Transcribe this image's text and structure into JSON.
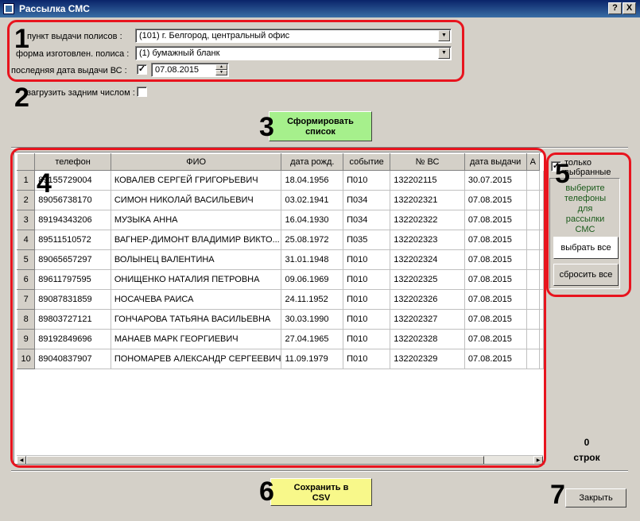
{
  "window": {
    "title": "Рассылка СМС",
    "help_label": "?",
    "close_label": "X"
  },
  "filters": {
    "issue_point_label": "пункт выдачи полисов :",
    "issue_point_value": "(101) г. Белгород, центральный офис",
    "policy_form_label": "форма изготовлен. полиса :",
    "policy_form_value": "(1) бумажный бланк",
    "last_date_label": "последняя дата выдачи ВС :",
    "last_date_checked": "✓",
    "last_date_value": "07.08.2015",
    "backdate_label": "загрузить задним числом :",
    "backdate_checked": ""
  },
  "actions": {
    "form_list_label_1": "Сформировать",
    "form_list_label_2": "список",
    "save_csv_label_1": "Сохранить в",
    "save_csv_label_2": "CSV",
    "close_label": "Закрыть"
  },
  "table": {
    "columns": [
      "телефон",
      "ФИО",
      "дата рожд.",
      "событие",
      "№ ВС",
      "дата выдачи",
      "А"
    ],
    "rows": [
      {
        "num": "1",
        "phone": "89155729004",
        "fio": "КОВАЛЕВ СЕРГЕЙ ГРИГОРЬЕВИЧ",
        "birth": "18.04.1956",
        "event": "П010",
        "vs": "132202115",
        "issued": "30.07.2015"
      },
      {
        "num": "2",
        "phone": "89056738170",
        "fio": "СИМОН НИКОЛАЙ ВАСИЛЬЕВИЧ",
        "birth": "03.02.1941",
        "event": "П034",
        "vs": "132202321",
        "issued": "07.08.2015"
      },
      {
        "num": "3",
        "phone": "89194343206",
        "fio": "МУЗЫКА АННА",
        "birth": "16.04.1930",
        "event": "П034",
        "vs": "132202322",
        "issued": "07.08.2015"
      },
      {
        "num": "4",
        "phone": "89511510572",
        "fio": "ВАГНЕР-ДИМОНТ ВЛАДИМИР ВИКТО...",
        "birth": "25.08.1972",
        "event": "П035",
        "vs": "132202323",
        "issued": "07.08.2015"
      },
      {
        "num": "5",
        "phone": "89065657297",
        "fio": "ВОЛЫНЕЦ ВАЛЕНТИНА",
        "birth": "31.01.1948",
        "event": "П010",
        "vs": "132202324",
        "issued": "07.08.2015"
      },
      {
        "num": "6",
        "phone": "89611797595",
        "fio": "ОНИЩЕНКО НАТАЛИЯ ПЕТРОВНА",
        "birth": "09.06.1969",
        "event": "П010",
        "vs": "132202325",
        "issued": "07.08.2015"
      },
      {
        "num": "7",
        "phone": "89087831859",
        "fio": "НОСАЧЕВА РАИСА",
        "birth": "24.11.1952",
        "event": "П010",
        "vs": "132202326",
        "issued": "07.08.2015"
      },
      {
        "num": "8",
        "phone": "89803727121",
        "fio": "ГОНЧАРОВА ТАТЬЯНА ВАСИЛЬЕВНА",
        "birth": "30.03.1990",
        "event": "П010",
        "vs": "132202327",
        "issued": "07.08.2015"
      },
      {
        "num": "9",
        "phone": "89192849696",
        "fio": "МАНАЕВ МАРК ГЕОРГИЕВИЧ",
        "birth": "27.04.1965",
        "event": "П010",
        "vs": "132202328",
        "issued": "07.08.2015"
      },
      {
        "num": "10",
        "phone": "89040837907",
        "fio": "ПОНОМАРЕВ АЛЕКСАНДР СЕРГЕЕВИЧ",
        "birth": "11.09.1979",
        "event": "П010",
        "vs": "132202329",
        "issued": "07.08.2015"
      }
    ]
  },
  "side": {
    "only_selected_label_1": "только",
    "only_selected_label_2": "выбранные",
    "only_selected_checked": "✓",
    "hint_1": "выберите",
    "hint_2": "телефоны",
    "hint_3": "для",
    "hint_4": "рассылки",
    "hint_5": "СМС",
    "select_all_label": "выбрать все",
    "reset_all_label": "сбросить все",
    "count_value": "0",
    "count_label": "строк"
  },
  "annotations": {
    "n1": "1",
    "n2": "2",
    "n3": "3",
    "n4": "4",
    "n5": "5",
    "n6": "6",
    "n7": "7",
    "box_color": "#e8141e"
  }
}
